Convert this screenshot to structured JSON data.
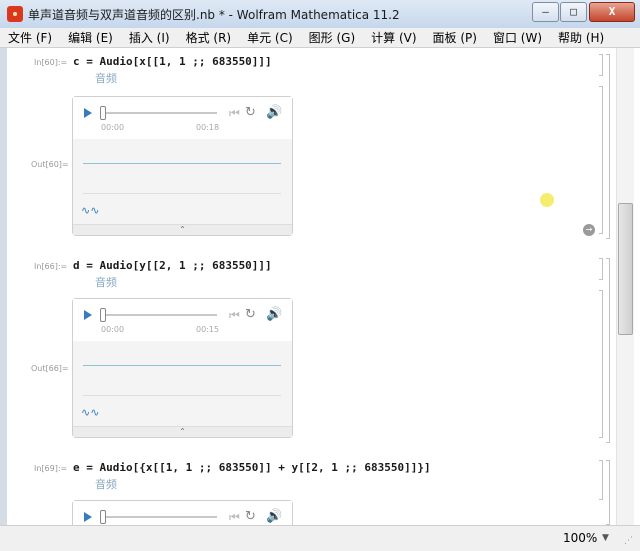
{
  "window": {
    "title": "单声道音频与双声道音频的区别.nb * - Wolfram Mathematica 11.2",
    "min_glyph": "—",
    "max_glyph": "□",
    "close_glyph": "X"
  },
  "menu": [
    "文件 (F)",
    "编辑 (E)",
    "插入 (I)",
    "格式 (R)",
    "单元 (C)",
    "图形 (G)",
    "计算 (V)",
    "面板 (P)",
    "窗口 (W)",
    "帮助 (H)"
  ],
  "cells": [
    {
      "in_label": "In[60]:=",
      "code": "c = Audio[x[[1, 1 ;; 683550]]]",
      "suggest": "音频",
      "out_label": "Out[60]=",
      "time_start": "00:00",
      "time_end": "00:18"
    },
    {
      "in_label": "In[66]:=",
      "code": "d = Audio[y[[2, 1 ;; 683550]]]",
      "suggest": "音频",
      "out_label": "Out[66]=",
      "time_start": "00:00",
      "time_end": "00:15"
    },
    {
      "in_label": "In[69]:=",
      "code": "e = Audio[{x[[1, 1 ;; 683550]] + y[[2, 1 ;; 683550]]}]",
      "suggest": "音频"
    }
  ],
  "icons": {
    "play": "play-icon",
    "skip": "skip-end-icon",
    "loop": "loop-icon",
    "volume": "volume-icon",
    "waveform": "waveform-icon",
    "expand": "chevron-up-icon",
    "nav": "arrow-right-circle-icon"
  },
  "glyphs": {
    "skip": "⏮",
    "loop": "↻",
    "volume": "🔊",
    "waveform": "∿∿",
    "expand": "⌃",
    "nav": "→",
    "zoom_arrow": "▼",
    "grip": "⋰"
  },
  "status": {
    "zoom": "100%"
  },
  "colors": {
    "accent": "#3a7bbf",
    "suggest": "#8aa9c4",
    "wave": "#8fc4d8"
  }
}
